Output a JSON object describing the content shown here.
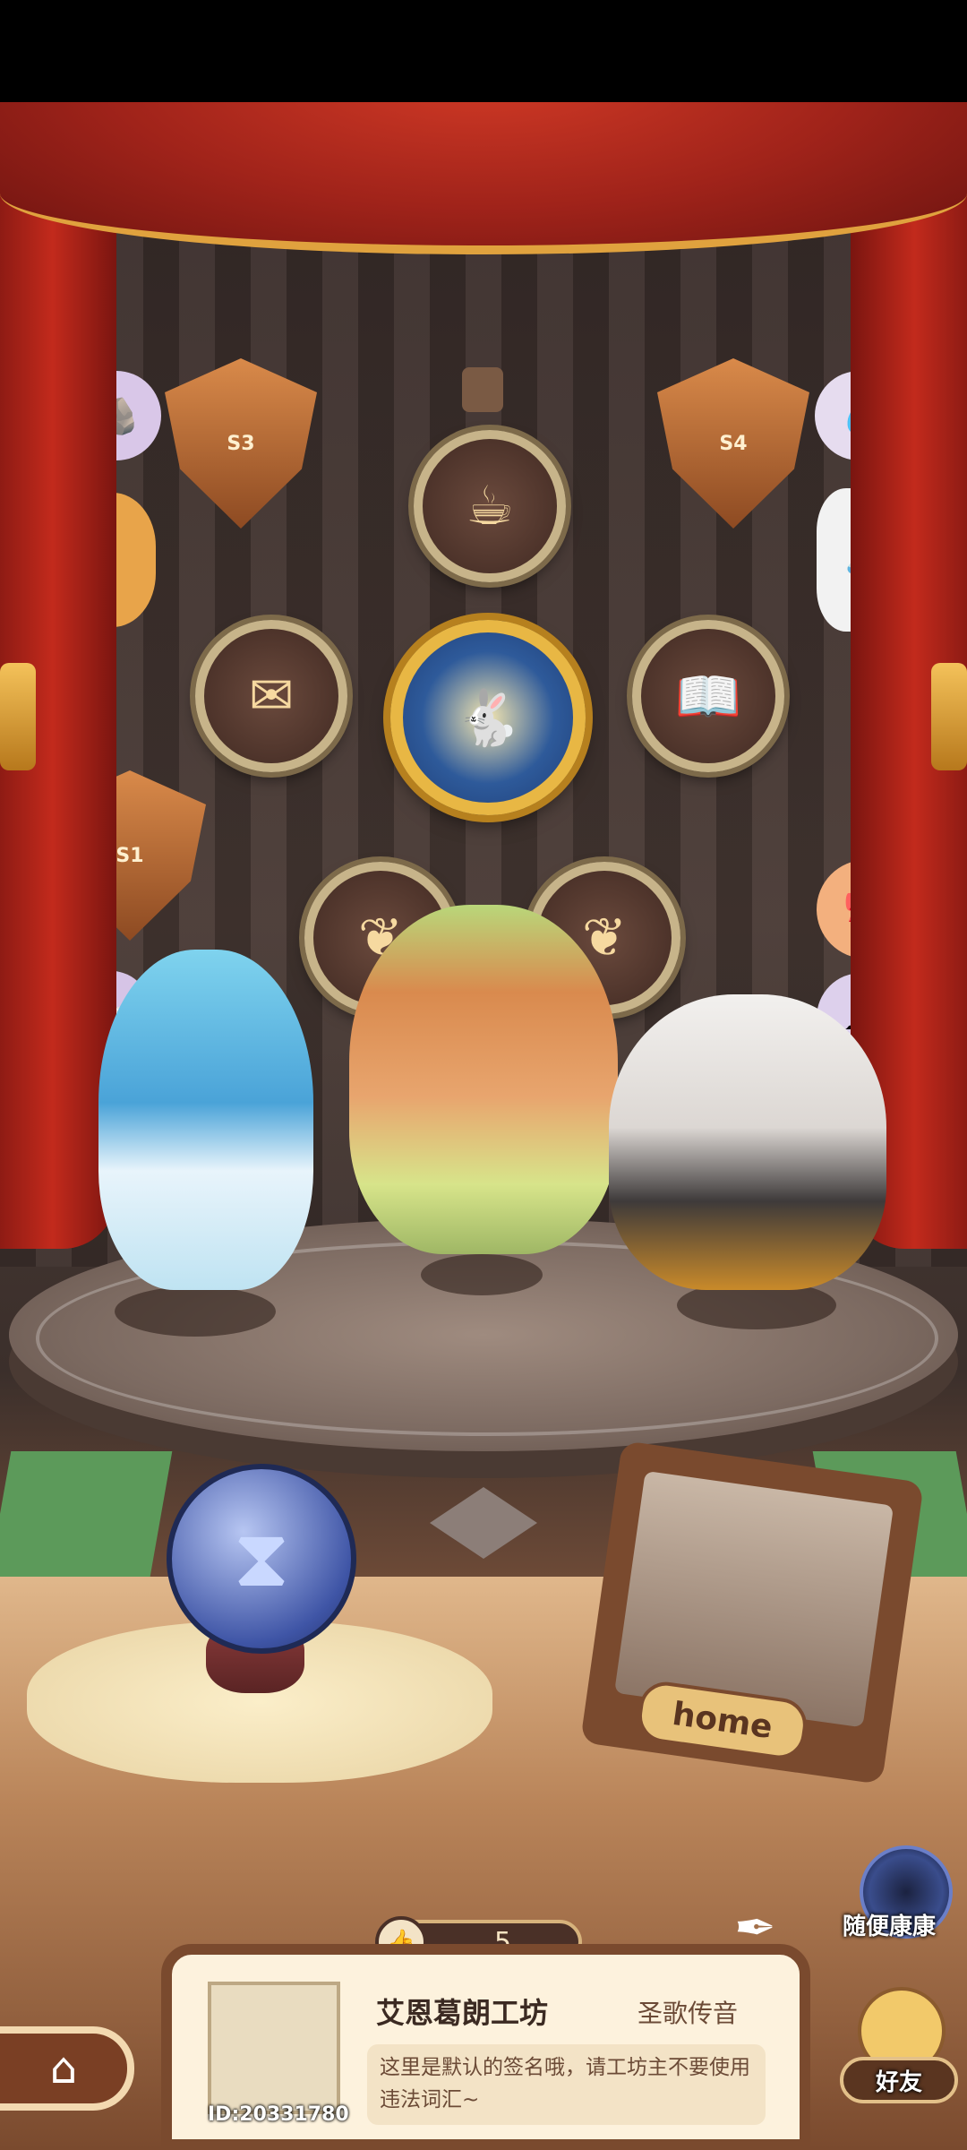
{
  "header": {
    "bar_color": "#000000"
  },
  "theater": {
    "badges": [
      {
        "name": "badge-pot-icon",
        "glyph": "☕"
      },
      {
        "name": "badge-letter-icon",
        "glyph": "✉"
      },
      {
        "name": "badge-book-icon",
        "glyph": "📖"
      },
      {
        "name": "badge-rabbit-icon",
        "glyph": "🐇"
      },
      {
        "name": "badge-leaf-left-icon",
        "glyph": "❦"
      },
      {
        "name": "badge-leaf-right-icon",
        "glyph": "❦"
      }
    ],
    "shields": [
      {
        "label": "S3"
      },
      {
        "label": "S4"
      },
      {
        "label": "S1"
      }
    ],
    "stickers": [
      {
        "glyph": "🪨"
      },
      {
        "glyph": "🦌"
      },
      {
        "glyph": "💧"
      },
      {
        "glyph": "🧦"
      },
      {
        "glyph": "🎀"
      },
      {
        "glyph": "☁"
      },
      {
        "glyph": "🍫"
      }
    ],
    "home_sign": "home",
    "crystal_ball_glyph": "⧗"
  },
  "sidebar_right": {
    "random_visit_label": "随便康康",
    "friends_label": "好友"
  },
  "profile": {
    "likes": "5",
    "name": "艾恩葛朗工坊",
    "title": "圣歌传音",
    "signature": "这里是默认的签名哦，请工坊主不要使用违法词汇~",
    "id": "ID:20331780"
  },
  "nav": {
    "home_icon": "⌂"
  },
  "colors": {
    "curtain": "#c22a1c",
    "gold": "#e8b744",
    "panel": "#fdf2dd",
    "frame": "#7a4a2e"
  }
}
